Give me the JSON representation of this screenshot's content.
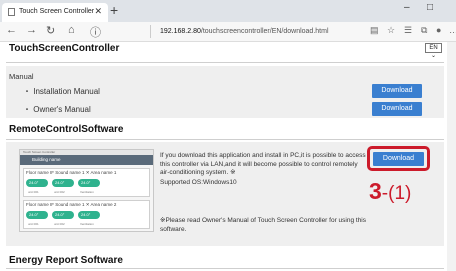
{
  "browser": {
    "tab_title": "Touch Screen Controller",
    "new_tab": "+",
    "url_host": "192.168.2.80",
    "url_path": "/touchscreencontroller/EN/download.html",
    "win_minimize": "–",
    "win_maximize": "□"
  },
  "header": {
    "title": "TouchScreenController",
    "language": "EN ⌄"
  },
  "manual": {
    "heading": "Manual",
    "items": [
      {
        "label": "・ Installation Manual",
        "button": "Download"
      },
      {
        "label": "・ Owner's Manual",
        "button": "Download"
      }
    ]
  },
  "remote": {
    "title": "RemoteControlSoftware",
    "description": "If you download this application and install in PC,it is possible to access this controller via LAN,and it will become possible to control remotely air-conditioning system. ※",
    "supported": "Supported OS:Windows10",
    "note": "※Please read Owner's Manual of Touch Screen Controller for using this software.",
    "button": "Download",
    "callout_num": "3",
    "callout_sub": "-(1)"
  },
  "preview": {
    "top_title": "Touch Screen Controller",
    "bar_title": "Building name",
    "card1_title": "Floor name  IF Sound name 1  ✕  Area name 1",
    "card2_title": "Floor name  IF Sound name 1  ✕  Area name 2",
    "temps": [
      "24.0°",
      "24.0°",
      "24.0°"
    ],
    "captions": [
      "unit 001",
      "unit 002",
      "Ventilation"
    ]
  },
  "energy": {
    "title": "Energy Report Software"
  },
  "colors": {
    "accent": "#3a7fd0",
    "callout": "#cc1b2b",
    "unit_pill": "#2fb28e"
  }
}
